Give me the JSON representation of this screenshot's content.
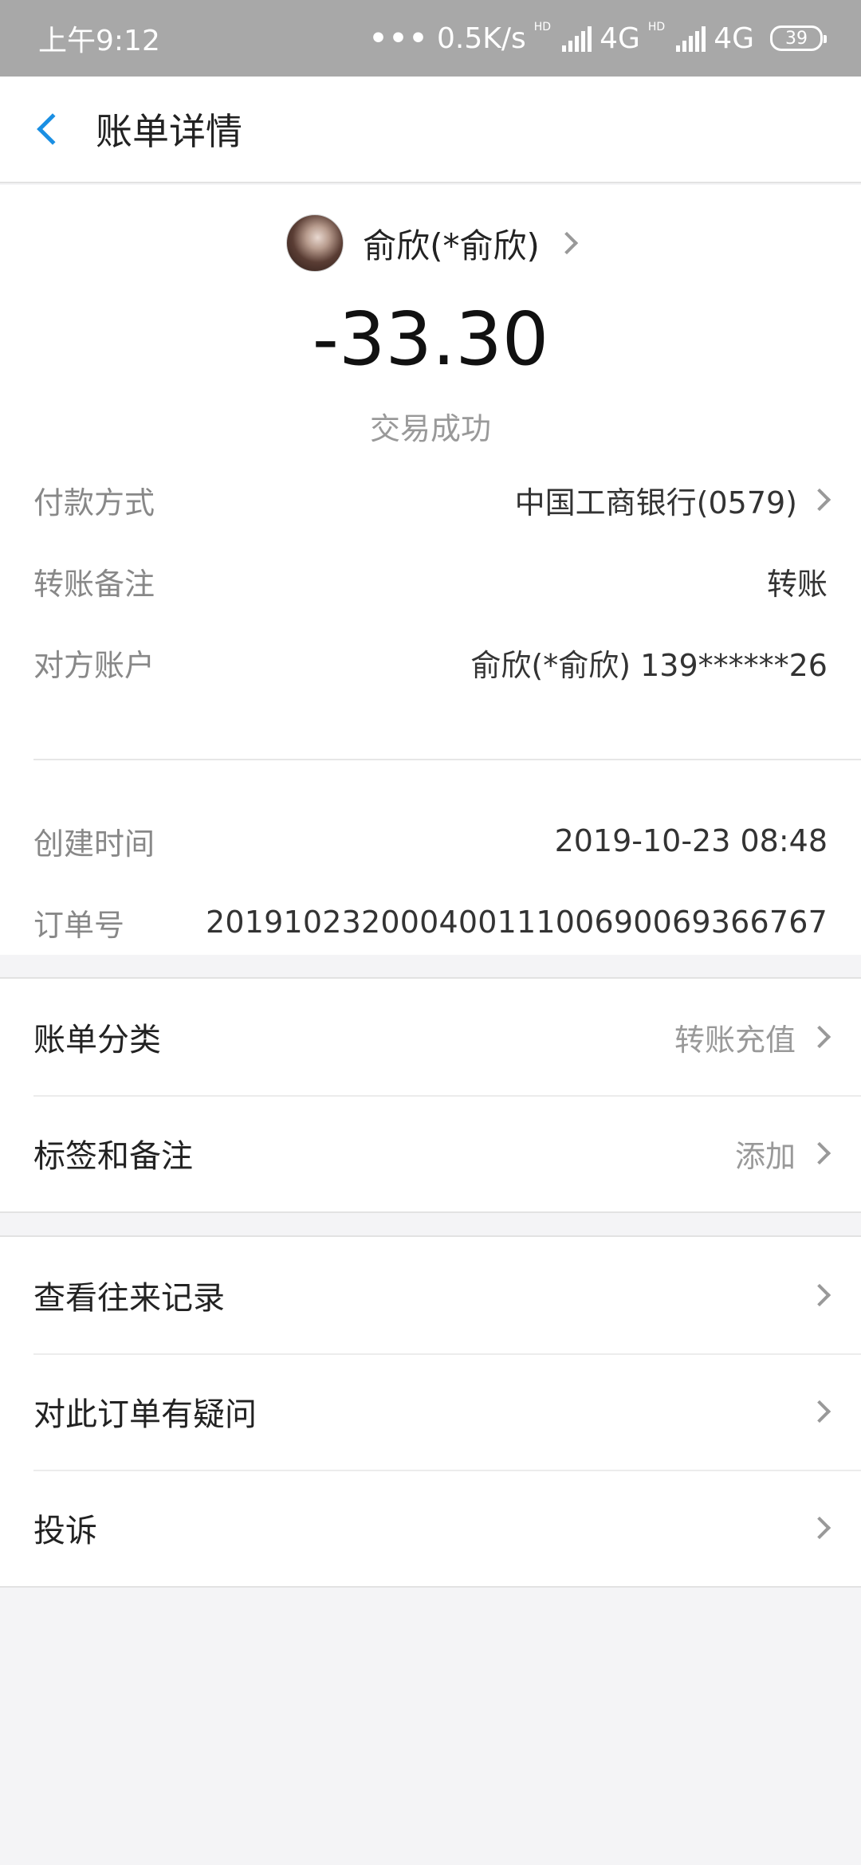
{
  "status_bar": {
    "time": "上午9:12",
    "net_speed": "0.5K/s",
    "network1": "4G",
    "network2": "4G",
    "hd": "HD",
    "battery": "39"
  },
  "header": {
    "title": "账单详情"
  },
  "payee": {
    "name": "俞欣(*俞欣)"
  },
  "amount": "-33.30",
  "status": "交易成功",
  "details": [
    {
      "label": "付款方式",
      "value": "中国工商银行(0579)"
    },
    {
      "label": "转账备注",
      "value": "转账"
    },
    {
      "label": "对方账户",
      "value": "俞欣(*俞欣) 139******26"
    },
    {
      "label": "创建时间",
      "value": "2019-10-23 08:48"
    },
    {
      "label": "订单号",
      "value": "20191023200040011100690069366767"
    }
  ],
  "category": {
    "label": "账单分类",
    "value": "转账充值"
  },
  "tags": {
    "label": "标签和备注",
    "value": "添加"
  },
  "actions": [
    {
      "label": "查看往来记录"
    },
    {
      "label": "对此订单有疑问"
    },
    {
      "label": "投诉"
    }
  ]
}
